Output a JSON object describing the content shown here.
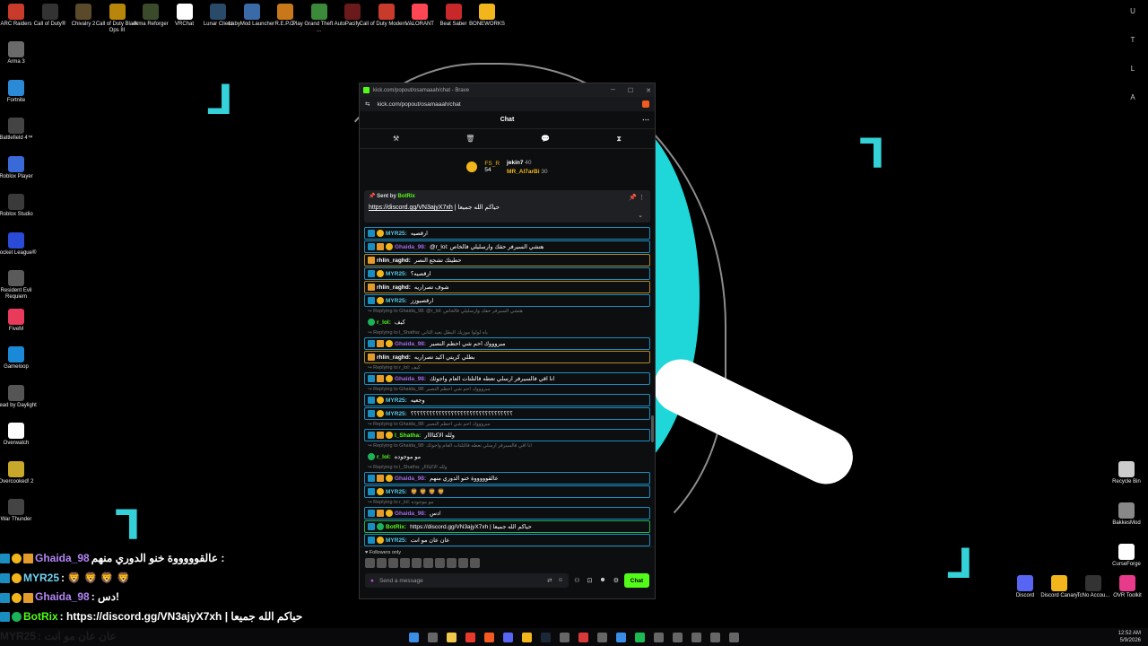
{
  "desktop": {
    "top_icons": [
      {
        "label": "ARC Raiders",
        "color": "#c83a2a"
      },
      {
        "label": "Call of Duty®",
        "color": "#333333"
      },
      {
        "label": "Chivalry 2",
        "color": "#5a4a2a"
      },
      {
        "label": "Call of Duty Black Ops III",
        "color": "#b8860b"
      },
      {
        "label": "Arma Reforger",
        "color": "#3a4a2a"
      },
      {
        "label": "VRChat",
        "color": "#ffffff"
      },
      {
        "label": "Lunar Client",
        "color": "#2a4a6a"
      },
      {
        "label": "LabyMod Launcher",
        "color": "#3a6aa8"
      },
      {
        "label": "R.E.P.O.",
        "color": "#c8781a"
      },
      {
        "label": "Play Grand Theft Auto ...",
        "color": "#3a8a3a"
      },
      {
        "label": "Pacify",
        "color": "#6a1a1a"
      },
      {
        "label": "Call of Duty Modern ...",
        "color": "#c83a2a"
      },
      {
        "label": "VALORANT",
        "color": "#ff4655"
      },
      {
        "label": "Beat Saber",
        "color": "#c8282a"
      },
      {
        "label": "BONEWORKS",
        "color": "#f2b61c"
      }
    ],
    "left_icons": [
      {
        "label": "Arma 3",
        "color": "#6a6a6a"
      },
      {
        "label": "Fortnite",
        "color": "#2a8ad8"
      },
      {
        "label": "Battlefield 4™",
        "color": "#444444"
      },
      {
        "label": "Roblox Player",
        "color": "#3a6ad8"
      },
      {
        "label": "Roblox Studio",
        "color": "#3a3a3a"
      },
      {
        "label": "Rocket League®",
        "color": "#2a4ad8"
      },
      {
        "label": "Resident Evil Requiem",
        "color": "#5a5a5a"
      },
      {
        "label": "FiveM",
        "color": "#e83a5a"
      },
      {
        "label": "Gameloop",
        "color": "#1a8ad8"
      },
      {
        "label": "Dead by Daylight",
        "color": "#555555"
      },
      {
        "label": "Overwatch",
        "color": "#ffffff"
      },
      {
        "label": "Overcooked! 2",
        "color": "#c8a82a"
      },
      {
        "label": "War Thunder",
        "color": "#444444"
      }
    ],
    "right_letters": [
      "U",
      "T",
      "L",
      "A"
    ],
    "right_icons": [
      {
        "label": "Recycle Bin",
        "color": "#cccccc"
      },
      {
        "label": "BakkesMod",
        "color": "#888888"
      },
      {
        "label": "CurseForge",
        "color": "#ffffff"
      }
    ],
    "bottom_right_icons": [
      {
        "label": "Discord",
        "color": "#5865f2"
      },
      {
        "label": "Discord Canary",
        "color": "#f2b61c"
      },
      {
        "label": "TcNo Accou...",
        "color": "#333333"
      },
      {
        "label": "OVR Toolkit",
        "color": "#e83a8a"
      }
    ]
  },
  "window": {
    "title": "kick.com/popout/osamaaah/chat - Brave",
    "url": "kick.com/popout/osamaaah/chat",
    "chat_title": "Chat",
    "tool_icons": [
      "hammer-icon",
      "trash-icon",
      "chat-bubble-icon",
      "hourglass-icon"
    ],
    "leaderboard": {
      "left": [
        {
          "name": "FS_R",
          "value": "54"
        }
      ],
      "right": [
        {
          "name": "jekin7",
          "value": "40"
        },
        {
          "name": "MR_Al7arBi",
          "value": "30"
        }
      ]
    },
    "pinned": {
      "sent_by_label": "Sent by",
      "sender": "BotRix",
      "link": "https://discord.gg/VN3ajyX7xh",
      "text": "| حياكم الله جميعا"
    },
    "messages": [
      {
        "kind": "msg",
        "style": "",
        "badges": [
          "b1",
          "b2"
        ],
        "user": "MYR25",
        "color": "#53c8e8",
        "text": "ارقصيه"
      },
      {
        "kind": "msg",
        "style": "",
        "badges": [
          "b1",
          "b3",
          "b2"
        ],
        "user": "Ghaida_98",
        "color": "#a06ae8",
        "text": "@r_lol: هتشي السيرفر حقك وارسليلي فالخاص"
      },
      {
        "kind": "msg",
        "style": "gold",
        "badges": [
          "b3"
        ],
        "user": "rhlin_raghd",
        "color": "#ffffff",
        "text": "حطيتك تشجع النصر"
      },
      {
        "kind": "msg",
        "style": "",
        "badges": [
          "b1",
          "b2"
        ],
        "user": "MYR25",
        "color": "#53c8e8",
        "text": "ارقصيه؟"
      },
      {
        "kind": "msg",
        "style": "gold",
        "badges": [
          "b3"
        ],
        "user": "rhlin_raghd",
        "color": "#ffffff",
        "text": "شوف تصراريه"
      },
      {
        "kind": "msg",
        "style": "",
        "badges": [
          "b1",
          "b2"
        ],
        "user": "MYR25",
        "color": "#53c8e8",
        "text": "ارقصيوزز"
      },
      {
        "kind": "reply",
        "text": "Replying to Ghaida_98: @r_lol: هتشي السيرفر حقك وارسليلي فالخاص"
      },
      {
        "kind": "msg",
        "style": "none",
        "badges": [
          "b4"
        ],
        "user": "r_lol",
        "color": "#53fc18",
        "text": "كيف"
      },
      {
        "kind": "reply",
        "text": "Replying to l_Shatha: ياه لولوا موزيك البطل بعيد الثاني"
      },
      {
        "kind": "msg",
        "style": "",
        "badges": [
          "b1",
          "b3",
          "b2"
        ],
        "user": "Ghaida_98",
        "color": "#a06ae8",
        "text": "مبروووك احم شي احظم النصير"
      },
      {
        "kind": "msg",
        "style": "gold",
        "badges": [
          "b3"
        ],
        "user": "rhlin_raghd",
        "color": "#ffffff",
        "text": "بطلي كريتي اكيد تصراريه"
      },
      {
        "kind": "reply",
        "text": "Replying to r_lol: كيف"
      },
      {
        "kind": "msg",
        "style": "",
        "badges": [
          "b1",
          "b3",
          "b2"
        ],
        "user": "Ghaida_98",
        "color": "#a06ae8",
        "text": "انا اقي فالسيرفر ارسلي تعطه فالتلتات العام واجوئك"
      },
      {
        "kind": "reply",
        "text": "Replying to Ghaida_98: مبروووك احم شي احظم النصير"
      },
      {
        "kind": "msg",
        "style": "",
        "badges": [
          "b1",
          "b2"
        ],
        "user": "MYR25",
        "color": "#53c8e8",
        "text": "وجعيه"
      },
      {
        "kind": "msg",
        "style": "",
        "badges": [
          "b1",
          "b2"
        ],
        "user": "MYR25",
        "color": "#53c8e8",
        "text": "؟؟؟؟؟؟؟؟؟؟؟؟؟؟؟؟؟؟؟؟؟؟؟؟؟؟؟؟؟؟؟؟؟"
      },
      {
        "kind": "reply",
        "text": "Replying to Ghaida_98: مبروووك احم شي احظم النصير"
      },
      {
        "kind": "msg",
        "style": "",
        "badges": [
          "b1",
          "b3",
          "b2"
        ],
        "user": "l_Shatha",
        "color": "#53fc18",
        "text": "ولله الاكثاااار"
      },
      {
        "kind": "reply",
        "text": "Replying to Ghaida_98: انا اقي فالسيرفر ارسلي تعطه فالتلتات العام واجوئك"
      },
      {
        "kind": "msg",
        "style": "none",
        "badges": [
          "b4"
        ],
        "user": "r_lol",
        "color": "#53fc18",
        "text": "مو موجوده"
      },
      {
        "kind": "reply",
        "text": "Replying to l_Shatha: ولله الاكثاااار"
      },
      {
        "kind": "msg",
        "style": "",
        "badges": [
          "b1",
          "b3",
          "b2"
        ],
        "user": "Ghaida_98",
        "color": "#a06ae8",
        "text": "عالقوووووة خنو الدوري منهم"
      },
      {
        "kind": "msg",
        "style": "",
        "badges": [
          "b1",
          "b2"
        ],
        "user": "MYR25",
        "color": "#53c8e8",
        "text": "🦁 🦁 🦁 🦁"
      },
      {
        "kind": "reply",
        "text": "Replying to r_lol: مو موجوده"
      },
      {
        "kind": "msg",
        "style": "",
        "badges": [
          "b1",
          "b3",
          "b2"
        ],
        "user": "Ghaida_98",
        "color": "#a06ae8",
        "text": "دس!"
      },
      {
        "kind": "msg",
        "style": "bot",
        "badges": [
          "b1",
          "b4"
        ],
        "user": "BotRix",
        "color": "#53fc18",
        "text": "https://discord.gg/VN3ajyX7xh | حياكم الله جميعا"
      },
      {
        "kind": "msg",
        "style": "",
        "badges": [
          "b1",
          "b2"
        ],
        "user": "MYR25",
        "color": "#53c8e8",
        "text": "عان عان مو انت"
      }
    ],
    "followers_label": "Followers only",
    "input_placeholder": "Send a message",
    "send_label": "Chat"
  },
  "overlay": [
    {
      "badges": [
        "b1",
        "b2",
        "b3"
      ],
      "user": "Ghaida_98",
      "color": "#b285f5",
      "text": "عالقوووووة خنو الدوري منهم :"
    },
    {
      "badges": [
        "b1",
        "b2"
      ],
      "user": "MYR25",
      "color": "#6fd3f2",
      "text": ": 🦁 🦁 🦁 🦁"
    },
    {
      "badges": [
        "b1",
        "b2",
        "b3"
      ],
      "user": "Ghaida_98",
      "color": "#b285f5",
      "text": ": دس!"
    },
    {
      "badges": [
        "b1",
        "b4"
      ],
      "user": "BotRix",
      "color": "#53fc18",
      "text": ": https://discord.gg/VN3ajyX7xh | حياكم الله جميعا"
    },
    {
      "badges": [],
      "user": "MYR25",
      "color": "#ffffff",
      "text": ": عان عان مو انت"
    }
  ],
  "taskbar": {
    "time": "12:52 AM",
    "date": "5/9/2026"
  }
}
